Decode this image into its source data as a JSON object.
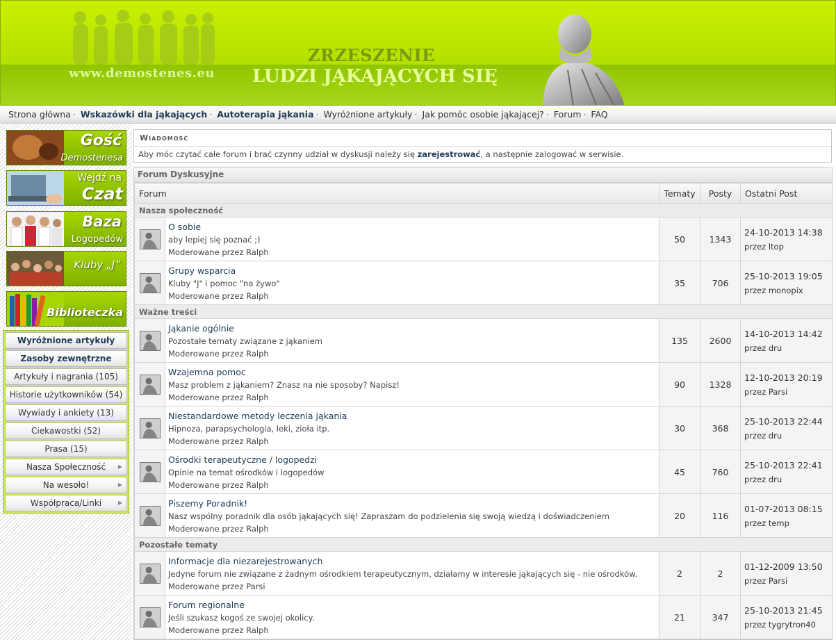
{
  "header": {
    "site_url": "www.demostenes.eu",
    "title_line1": "ZRZESZENIE",
    "title_line2": "LUDZI JĄKAJĄCYCH SIĘ"
  },
  "topnav": [
    {
      "label": "Strona główna",
      "bold": false
    },
    {
      "label": "Wskazówki dla jąkających",
      "bold": true
    },
    {
      "label": "Autoterapia jąkania",
      "bold": true
    },
    {
      "label": "Wyróżnione artykuły",
      "bold": false
    },
    {
      "label": "Jak pomóc osobie jąkającej?",
      "bold": false
    },
    {
      "label": "Forum",
      "bold": false
    },
    {
      "label": "FAQ",
      "bold": false
    }
  ],
  "banners": [
    {
      "line1": "Gość",
      "line2": "Demostenesa"
    },
    {
      "line1": "Wejdź na",
      "line2": "Czat"
    },
    {
      "line1": "Baza",
      "line2": "Logopedów"
    },
    {
      "line1": "Kluby „J”",
      "line2": ""
    },
    {
      "line1": "",
      "line2": "Biblioteczka"
    }
  ],
  "sidemenu": {
    "items": [
      {
        "label": "Wyróżnione artykuły",
        "bold": true,
        "arrow": false
      },
      {
        "label": "Zasoby zewnętrzne",
        "bold": true,
        "arrow": false
      },
      {
        "label": "Artykuły i nagrania (105)",
        "bold": false,
        "arrow": false
      },
      {
        "label": "Historie użytkowników (54)",
        "bold": false,
        "arrow": false
      },
      {
        "label": "Wywiady i ankiety (13)",
        "bold": false,
        "arrow": false
      },
      {
        "label": "Ciekawostki (52)",
        "bold": false,
        "arrow": false
      },
      {
        "label": "Prasa (15)",
        "bold": false,
        "arrow": false
      },
      {
        "label": "Nasza Społeczność",
        "bold": false,
        "arrow": true
      },
      {
        "label": "Na wesoło!",
        "bold": false,
        "arrow": true
      },
      {
        "label": "Współpraca/Linki",
        "bold": false,
        "arrow": true
      }
    ],
    "arrow_glyph": "▶"
  },
  "message": {
    "heading": "Wiadomość",
    "text_before": "Aby móc czytać całe forum i brać czynny udział w dyskusji należy się ",
    "link": "zarejestrować",
    "text_after": ", a następnie zalogować w serwisie."
  },
  "forum": {
    "title": "Forum Dyskusyjne",
    "columns": {
      "forum": "Forum",
      "topics": "Tematy",
      "posts": "Posty",
      "last": "Ostatni Post"
    },
    "categories": [
      {
        "name": "Nasza społeczność",
        "forums": [
          {
            "name": "O sobie",
            "desc": "aby lepiej się poznać ;)",
            "mod": "Moderowane przez Ralph",
            "topics": "50",
            "posts": "1343",
            "last_date": "24-10-2013 14:38",
            "last_by": "przez ltop"
          },
          {
            "name": "Grupy wsparcia",
            "desc": "Kluby \"J\" i pomoc \"na żywo\"",
            "mod": "Moderowane przez Ralph",
            "topics": "35",
            "posts": "706",
            "last_date": "25-10-2013 19:05",
            "last_by": "przez monopix"
          }
        ]
      },
      {
        "name": "Ważne treści",
        "forums": [
          {
            "name": "Jąkanie ogólnie",
            "desc": "Pozostałe tematy związane z jąkaniem",
            "mod": "Moderowane przez Ralph",
            "topics": "135",
            "posts": "2600",
            "last_date": "14-10-2013 14:42",
            "last_by": "przez dru"
          },
          {
            "name": "Wzajemna pomoc",
            "desc": "Masz problem z jąkaniem? Znasz na nie sposoby? Napisz!",
            "mod": "Moderowane przez Ralph",
            "topics": "90",
            "posts": "1328",
            "last_date": "12-10-2013 20:19",
            "last_by": "przez Parsi"
          },
          {
            "name": "Niestandardowe metody leczenia jąkania",
            "desc": "Hipnoza, parapsychologia, leki, zioła itp.",
            "mod": "Moderowane przez Ralph",
            "topics": "30",
            "posts": "368",
            "last_date": "25-10-2013 22:44",
            "last_by": "przez dru"
          },
          {
            "name": "Ośrodki terapeutyczne / logopedzi",
            "desc": "Opinie na temat ośrodków i logopedów",
            "mod": "Moderowane przez Ralph",
            "topics": "45",
            "posts": "760",
            "last_date": "25-10-2013 22:41",
            "last_by": "przez dru"
          },
          {
            "name": "Piszemy Poradnik!",
            "desc": "Nasz wspólny poradnik dla osób jąkających się! Zapraszam do podzielenia się swoją wiedzą i doświadczeniem",
            "mod": "Moderowane przez Ralph",
            "topics": "20",
            "posts": "116",
            "last_date": "01-07-2013 08:15",
            "last_by": "przez temp"
          }
        ]
      },
      {
        "name": "Pozostałe tematy",
        "forums": [
          {
            "name": "Informacje dla niezarejestrowanych",
            "desc": "Jedyne forum nie związane z żadnym ośrodkiem terapeutycznym, działamy w interesie jąkających się - nie ośrodków.",
            "mod": "Moderowane przez Parsi",
            "topics": "2",
            "posts": "2",
            "last_date": "01-12-2009 13:50",
            "last_by": "przez Parsi"
          },
          {
            "name": "Forum regionalne",
            "desc": "Jeśli szukasz kogoś ze swojej okolicy.",
            "mod": "Moderowane przez Ralph",
            "topics": "21",
            "posts": "347",
            "last_date": "25-10-2013 21:45",
            "last_by": "przez tygrytron40"
          }
        ]
      }
    ]
  }
}
